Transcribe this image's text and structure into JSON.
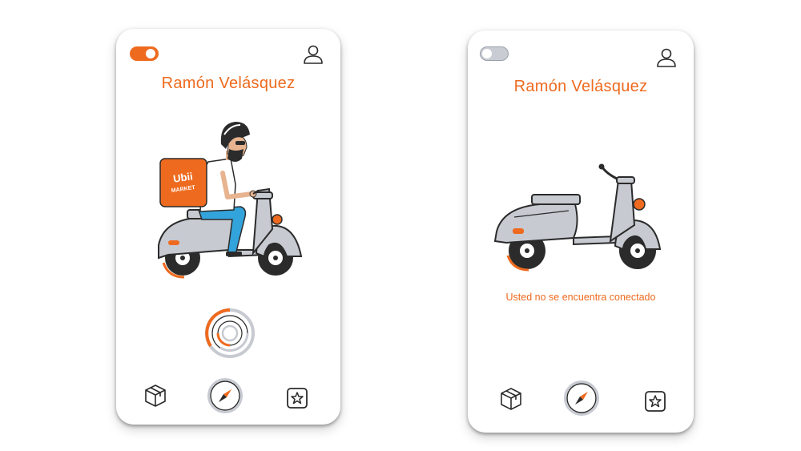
{
  "screens": [
    {
      "state": "connected",
      "toggle": "on",
      "courier_name": "Ramón Velásquez",
      "backpack_logo": "Ubii MARKET",
      "icons": [
        "profile-icon",
        "box-icon",
        "compass-icon",
        "star-icon"
      ]
    },
    {
      "state": "disconnected",
      "toggle": "off",
      "courier_name": "Ramón Velásquez",
      "status_message": "Usted no se encuentra conectado",
      "icons": [
        "profile-icon",
        "box-icon",
        "compass-icon",
        "star-icon"
      ]
    }
  ],
  "colors": {
    "accent": "#ee6a1e",
    "scooter_body": "#c7cad1",
    "outline": "#2b2b2b",
    "jeans": "#33a3dc",
    "toggle_off": "#c9ccd3"
  }
}
